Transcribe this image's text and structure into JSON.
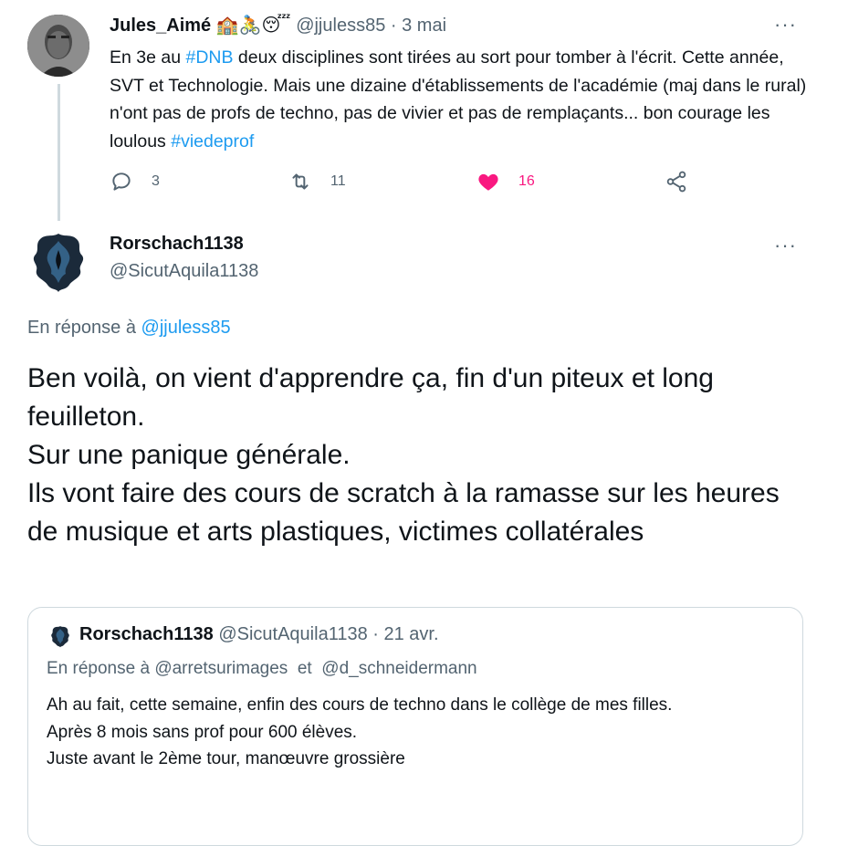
{
  "tweet1": {
    "author_name": "Jules_Aimé",
    "name_emojis": "🏫🚴😴",
    "handle": "@jjuless85",
    "separator": "·",
    "date": "3 mai",
    "more": "···",
    "text_parts": {
      "p1": "En 3e au ",
      "hashtag1": "#DNB",
      "p2": " deux disciplines sont tirées au sort pour tomber à l'écrit. Cette année,  SVT et Technologie. Mais une dizaine d'établissements de l'académie (maj dans le rural) n'ont pas de profs de techno, pas de vivier et pas de remplaçants... bon courage les loulous ",
      "hashtag2": "#viedeprof"
    },
    "actions": {
      "reply_count": "3",
      "retweet_count": "11",
      "like_count": "16"
    }
  },
  "tweet2": {
    "author_name": "Rorschach1138",
    "handle": "@SicutAquila1138",
    "more": "···",
    "reply_prefix": "En réponse à ",
    "reply_to": "@jjuless85",
    "text_lines": [
      "Ben voilà, on vient d'apprendre ça, fin d'un piteux et long feuilleton.",
      "Sur une panique générale.",
      "Ils vont faire des cours de scratch à la ramasse sur les heures de musique et arts plastiques, victimes collatérales"
    ]
  },
  "quote": {
    "author_name": "Rorschach1138",
    "handle": "@SicutAquila1138",
    "separator": "·",
    "date": "21 avr.",
    "reply_prefix": "En réponse à ",
    "reply_to1": "@arretsurimages",
    "reply_and": "  et  ",
    "reply_to2": "@d_schneidermann",
    "text_lines": [
      "Ah au fait, cette semaine, enfin des cours de techno dans le collège de mes filles.",
      "Après 8 mois sans prof pour 600 élèves.",
      "Juste avant le 2ème tour, manœuvre grossière"
    ]
  },
  "colors": {
    "link": "#1d9bf0",
    "muted": "#536471",
    "like": "#f91880",
    "border": "#cfd9de"
  }
}
